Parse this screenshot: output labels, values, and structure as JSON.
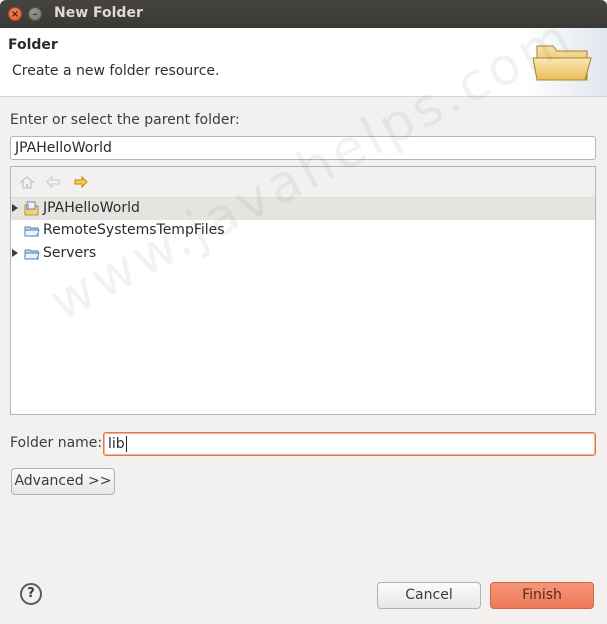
{
  "window": {
    "title": "New Folder",
    "close_glyph": "×",
    "min_glyph": "–"
  },
  "header": {
    "title": "Folder",
    "description": "Create a new folder resource.",
    "icon": "folder-open-icon"
  },
  "parent": {
    "label": "Enter or select the parent folder:",
    "value": "JPAHelloWorld"
  },
  "tree_toolbar": {
    "icons": [
      "home-icon",
      "back-arrow-icon",
      "forward-arrow-icon"
    ]
  },
  "tree": {
    "items": [
      {
        "label": "JPAHelloWorld",
        "expandable": true,
        "selected": true,
        "icon": "project-icon"
      },
      {
        "label": "RemoteSystemsTempFiles",
        "expandable": false,
        "selected": false,
        "icon": "folder-icon"
      },
      {
        "label": "Servers",
        "expandable": true,
        "selected": false,
        "icon": "folder-icon"
      }
    ]
  },
  "folder_name": {
    "label": "Folder name:",
    "value": "lib"
  },
  "buttons": {
    "advanced": "Advanced >>",
    "cancel": "Cancel",
    "finish": "Finish",
    "help": "?"
  },
  "watermark": "www.javahelps.com",
  "colors": {
    "accent": "#ee7a57",
    "titlebar": "#3a3935",
    "background": "#f2f1f0"
  }
}
